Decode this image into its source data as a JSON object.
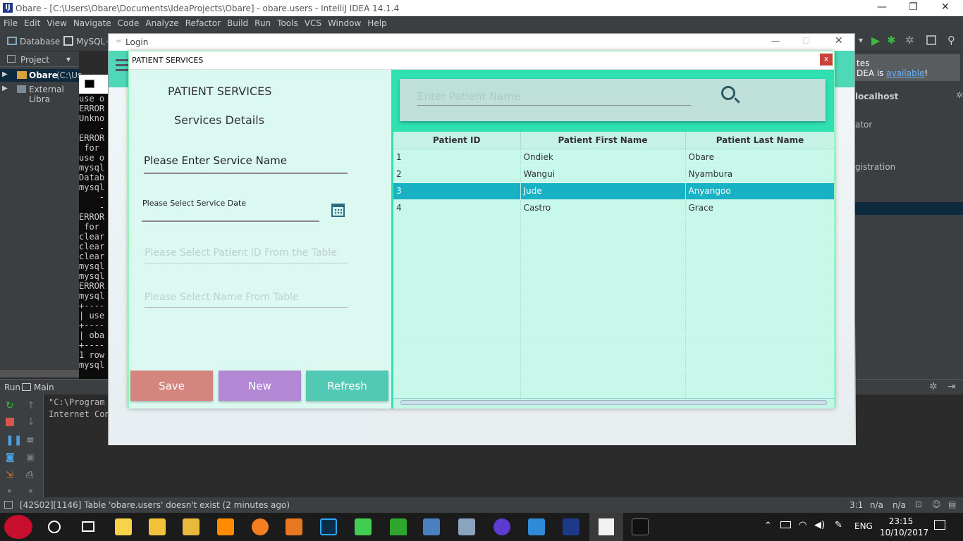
{
  "ide": {
    "title": "Obare - [C:\\Users\\Obare\\Documents\\IdeaProjects\\Obare] - obare.users - IntelliJ IDEA 14.1.4",
    "menu": [
      "File",
      "Edit",
      "View",
      "Navigate",
      "Code",
      "Analyze",
      "Refactor",
      "Build",
      "Run",
      "Tools",
      "VCS",
      "Window",
      "Help"
    ],
    "toolbar": {
      "database": "Database",
      "mysql": "MySQL",
      "dash": "-"
    },
    "project_label": "Project",
    "tree": {
      "obare": "Obare",
      "obare_path": "(C:\\Us",
      "external": "External Libra"
    },
    "console_lines": [
      "use o",
      "ERROR",
      "Unkno",
      "    -",
      "ERROR",
      " for ",
      "use o",
      "mysql",
      "Datab",
      "mysql",
      "    -",
      "    -",
      "ERROR",
      " for ",
      "clear",
      "clear",
      "clear",
      "mysql",
      "mysql",
      "ERROR",
      "mysql",
      "+----",
      "| use",
      "+----",
      "| oba",
      "+----",
      "1 row",
      "",
      "mysql"
    ],
    "right_panel": {
      "notice_top": "tes",
      "notice_bottom_pre": "DEA is ",
      "notice_link": "available",
      "notice_excl": "!",
      "localhost": "localhost",
      "ator": "ator",
      "registration": "gistration"
    },
    "run_tab": "Run",
    "main_tab": "Main",
    "run_output": [
      "\"C:\\Program",
      "Internet Con"
    ],
    "status": {
      "message": "[42S02][1146] Table 'obare.users' doesn't exist (2 minutes ago)",
      "pos": "3:1",
      "na1": "n/a",
      "na2": "n/a"
    },
    "clock": {
      "time": "23:15",
      "date": "10/10/2017",
      "lang": "ENG"
    }
  },
  "login_window": {
    "title": "Login"
  },
  "dialog": {
    "title": "PATIENT SERVICES",
    "close": "x",
    "left": {
      "heading": "PATIENT SERVICES",
      "subheading": "Services Details",
      "service_name_placeholder": "Please Enter Service Name",
      "service_date_label": "Please Select Service Date",
      "patient_id_placeholder": "Please Select Patient ID From the Table",
      "name_placeholder": "Please Select Name From Table",
      "buttons": {
        "save": "Save",
        "new": "New",
        "refresh": "Refresh"
      },
      "colors": {
        "save": "#d4857d",
        "new": "#b288d4",
        "refresh": "#52c9b4"
      }
    },
    "search": {
      "placeholder": "Enter Patient Name"
    },
    "table": {
      "headers": [
        "Patient ID",
        "Patient First Name",
        "Patient Last Name"
      ],
      "rows": [
        [
          "1",
          "Ondiek",
          "Obare"
        ],
        [
          "2",
          "Wangui",
          "Nyambura"
        ],
        [
          "3",
          "Jude",
          "Anyangoo"
        ],
        [
          "4",
          "Castro",
          "Grace"
        ]
      ],
      "selected_row": 3
    }
  }
}
